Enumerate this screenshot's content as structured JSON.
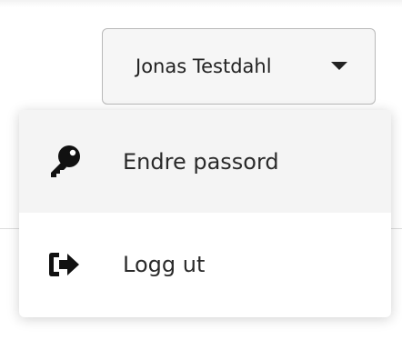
{
  "user_menu": {
    "username": "Jonas Testdahl",
    "items": [
      {
        "label": "Endre passord",
        "icon": "key-icon"
      },
      {
        "label": "Logg ut",
        "icon": "sign-out-icon"
      }
    ]
  }
}
